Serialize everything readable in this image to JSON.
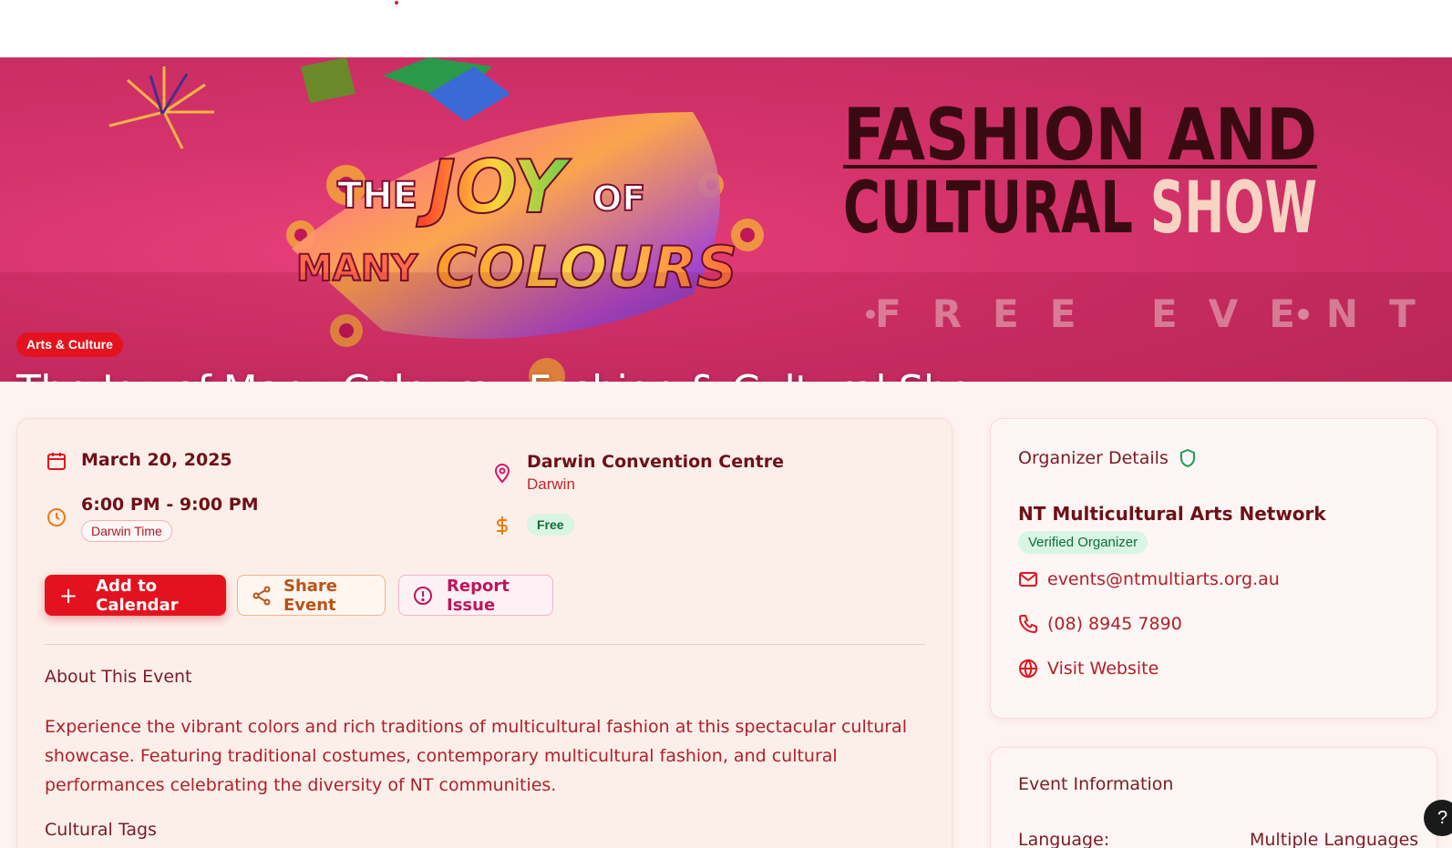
{
  "hero": {
    "category_badge": "Arts & Culture",
    "title": "The Joy of Many Colours - Fashion & Cultural Show",
    "image_text": {
      "line_the": "THE",
      "line_joy": "JOY",
      "line_of": "OF",
      "line_many": "MANY",
      "line_colours": "COLOURS",
      "headline_1": "FASHION AND",
      "headline_2a": "CULTURAL",
      "headline_2b": "SHOW",
      "free_event": "FREE EVENT"
    }
  },
  "event": {
    "date": "March 20, 2025",
    "time": "6:00 PM - 9:00 PM",
    "timezone": "Darwin Time",
    "venue": "Darwin Convention Centre",
    "city": "Darwin",
    "price": "Free"
  },
  "actions": {
    "add_to_calendar": "Add to Calendar",
    "share": "Share Event",
    "report": "Report Issue"
  },
  "about": {
    "heading": "About This Event",
    "description": "Experience the vibrant colors and rich traditions of multicultural fashion at this spectacular cultural showcase. Featuring traditional costumes, contemporary multicultural fashion, and cultural performances celebrating the diversity of NT communities.",
    "tags_heading": "Cultural Tags"
  },
  "organizer": {
    "heading": "Organizer Details",
    "name": "NT Multicultural Arts Network",
    "verified_label": "Verified Organizer",
    "email": "events@ntmultiarts.org.au",
    "phone": "(08) 8945 7890",
    "website_label": "Visit Website"
  },
  "event_info": {
    "heading": "Event Information",
    "language_label": "Language:",
    "language_value": "Multiple Languages"
  },
  "help_button": "?",
  "colors": {
    "accent_red": "#e4121f",
    "hero_pink": "#d6336c",
    "verified_green": "#136b3a",
    "page_bg": "#fdf3f1"
  }
}
